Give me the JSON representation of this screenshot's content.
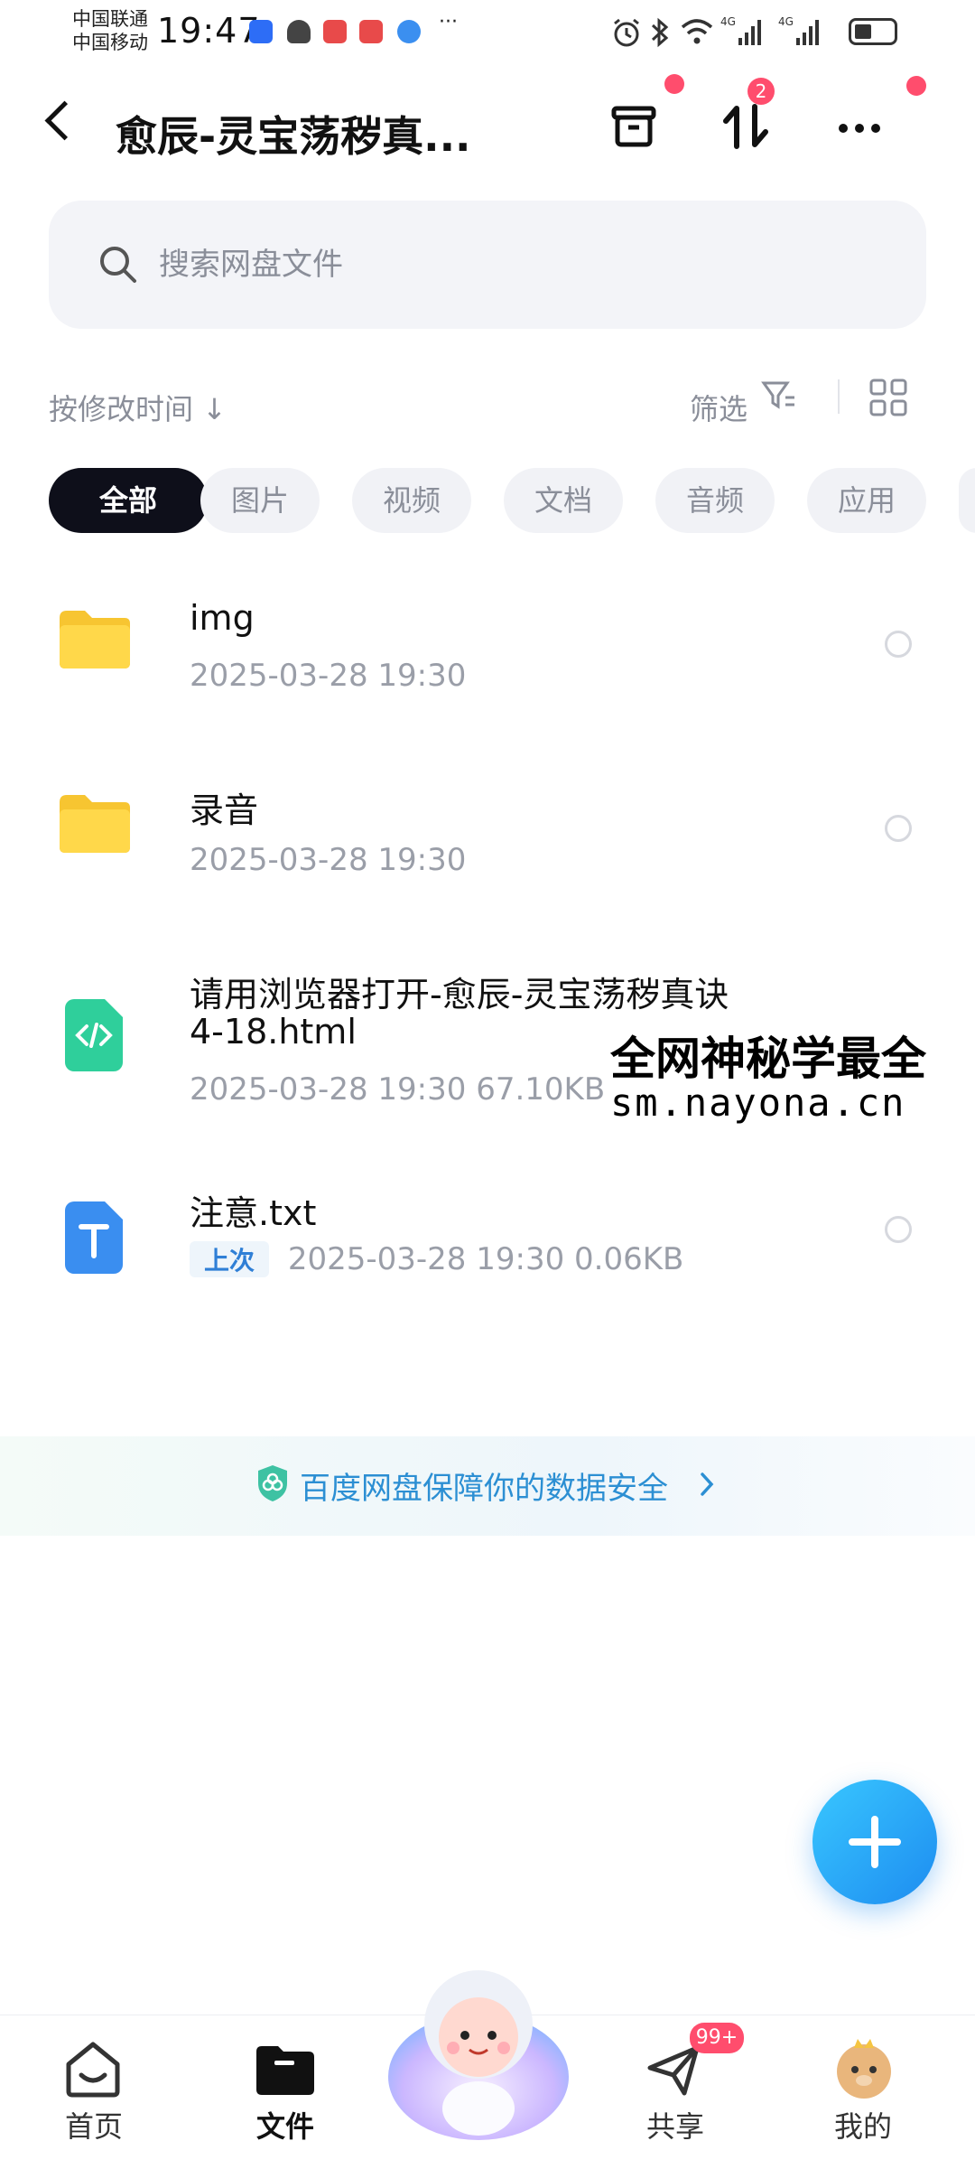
{
  "status_bar": {
    "carrier_1": "中国联通",
    "carrier_2": "中国移动",
    "time": "19:47",
    "more": "···"
  },
  "header": {
    "title": "愈辰-灵宝荡秽真..."
  },
  "transfer_badge": "2",
  "search": {
    "placeholder": "搜索网盘文件"
  },
  "toolbar": {
    "sort_label": "按修改时间 ↓",
    "filter_label": "筛选"
  },
  "categories": [
    {
      "label": "全部",
      "active": true
    },
    {
      "label": "图片"
    },
    {
      "label": "视频"
    },
    {
      "label": "文档"
    },
    {
      "label": "音频"
    },
    {
      "label": "应用"
    }
  ],
  "files": [
    {
      "name": "img",
      "meta": "2025-03-28  19:30",
      "type": "folder"
    },
    {
      "name": "录音",
      "meta": "2025-03-28  19:30",
      "type": "folder"
    },
    {
      "name_line1": "请用浏览器打开-愈辰-灵宝荡秽真诀",
      "name_line2": "4-18.html",
      "meta": "2025-03-28  19:30  67.10KB",
      "type": "html"
    },
    {
      "name": "注意.txt",
      "tag": "上次",
      "meta": "2025-03-28  19:30  0.06KB",
      "type": "txt"
    }
  ],
  "watermark": {
    "line1": "全网神秘学最全",
    "line2": "sm.nayona.cn"
  },
  "safety_banner": "百度网盘保障你的数据安全",
  "bottom_nav": {
    "home": "首页",
    "files": "文件",
    "share": "共享",
    "share_badge": "99+",
    "mine": "我的"
  },
  "colors": {
    "accent": "#1d8cf0",
    "badge": "#ff4d6d",
    "chip_active": "#0e0f1a",
    "folder": "#ffd23f",
    "html_icon": "#2fcf9b",
    "txt_icon": "#3a8ef0"
  }
}
